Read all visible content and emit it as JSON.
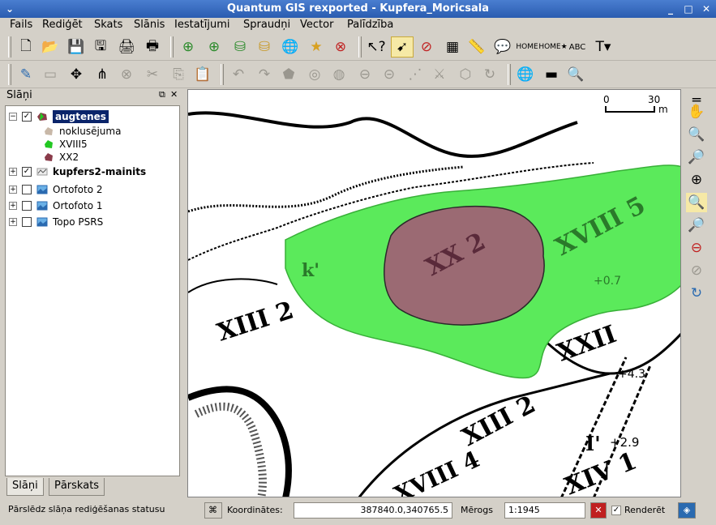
{
  "window": {
    "title": "Quantum GIS rexported - Kupfera_Moricsala"
  },
  "menu": [
    "Fails",
    "Rediģēt",
    "Skats",
    "Slānis",
    "Iestatījumi",
    "Spraudņi",
    "Vector",
    "Palīdzība"
  ],
  "layers_panel": {
    "title": "Slāņi",
    "layers": [
      {
        "name": "augtenes",
        "checked": true,
        "expanded": true,
        "selected": true
      },
      {
        "name": "noklusējuma",
        "swatch_color": "#c8b8a8"
      },
      {
        "name": "XVIII5",
        "swatch_color": "#22c822"
      },
      {
        "name": "XX2",
        "swatch_color": "#8a3b4a"
      },
      {
        "name": "kupfers2-mainits",
        "checked": true
      },
      {
        "name": "Ortofoto 2",
        "checked": false
      },
      {
        "name": "Ortofoto 1",
        "checked": false
      },
      {
        "name": "Topo PSRS",
        "checked": false
      }
    ],
    "tabs": [
      "Slāņi",
      "Pārskats"
    ]
  },
  "map": {
    "scale_bar": {
      "start": "0",
      "end": "30",
      "unit": "m"
    },
    "labels": [
      "XX 2",
      "XVIII 5",
      "k'",
      "+0.7",
      "XIII 2",
      "XXII",
      "XIII 2",
      "XIV 1",
      "XVIII 4",
      "I'",
      "+2.9",
      "+4.3"
    ],
    "colors": {
      "green_polygon": "#5bea5b",
      "maroon_polygon": "#9b6a73"
    }
  },
  "status": {
    "message": "Pārslēdz slāņa rediģēšanas statusu",
    "coord_label": "Koordinātes:",
    "coord_value": "387840.0,340765.5",
    "scale_label": "Mērogs",
    "scale_value": "1:1945",
    "render_label": "Renderēt",
    "render_checked": true
  }
}
